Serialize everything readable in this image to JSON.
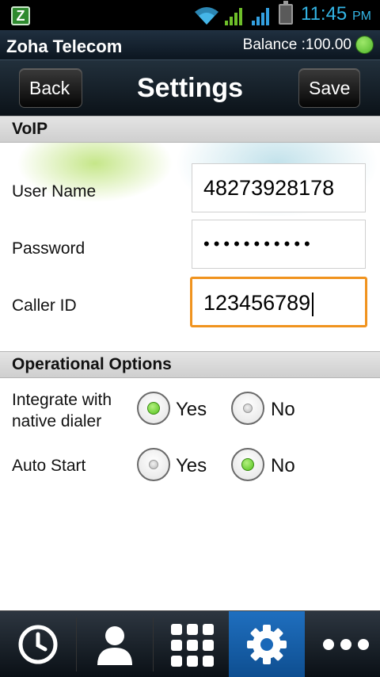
{
  "status_bar": {
    "time": "11:45",
    "ampm": "PM",
    "app_icon_letter": "Z",
    "icons": [
      "app-icon",
      "wifi-icon",
      "signal-icon",
      "signal-icon",
      "battery-icon"
    ]
  },
  "header": {
    "app_name": "Zoha Telecom",
    "balance": "Balance :100.00",
    "status_color": "#5cc22a"
  },
  "titlebar": {
    "back_label": "Back",
    "title": "Settings",
    "save_label": "Save"
  },
  "voip": {
    "section_title": "VoIP",
    "username_label": "User Name",
    "username_value": "48273928178",
    "password_label": "Password",
    "password_value": "•••••••••••",
    "callerid_label": "Caller ID",
    "callerid_value": "123456789"
  },
  "options": {
    "section_title": "Operational Options",
    "integrate_label_line1": "Integrate with",
    "integrate_label_line2": "native dialer",
    "integrate_yes": "Yes",
    "integrate_no": "No",
    "integrate_selected": "Yes",
    "autostart_label": "Auto Start",
    "autostart_yes": "Yes",
    "autostart_no": "No",
    "autostart_selected": "No"
  },
  "bottom_nav": {
    "items": [
      "clock-icon",
      "contacts-icon",
      "dialpad-icon",
      "settings-icon",
      "more-icon"
    ],
    "active": "settings-icon",
    "accent": "#1a68b8"
  }
}
